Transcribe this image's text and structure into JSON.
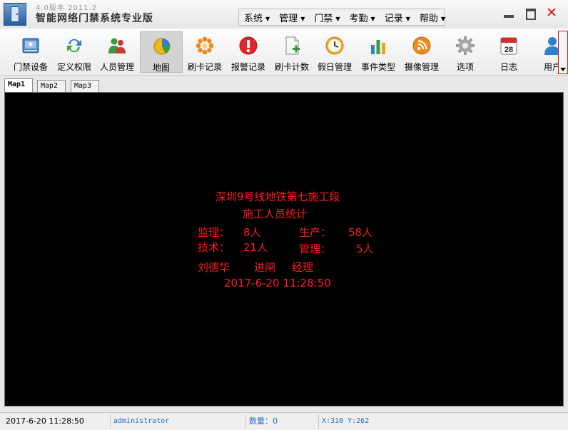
{
  "app": {
    "version": "4.0版本 2011.2",
    "title": "智能网络门禁系统专业版"
  },
  "menu": [
    {
      "label": "系统"
    },
    {
      "label": "管理"
    },
    {
      "label": "门禁"
    },
    {
      "label": "考勤"
    },
    {
      "label": "记录"
    },
    {
      "label": "帮助"
    }
  ],
  "toolbar": [
    {
      "label": "门禁设备",
      "icon": "door-device-icon"
    },
    {
      "label": "定义权限",
      "icon": "permission-arrows-icon"
    },
    {
      "label": "人员管理",
      "icon": "people-icon"
    },
    {
      "label": "地图",
      "icon": "map-pie-icon",
      "active": true
    },
    {
      "label": "刷卡记录",
      "icon": "card-record-icon"
    },
    {
      "label": "报警记录",
      "icon": "alarm-icon"
    },
    {
      "label": "刷卡计数",
      "icon": "card-count-icon"
    },
    {
      "label": "假日管理",
      "icon": "clock-icon"
    },
    {
      "label": "事件类型",
      "icon": "bar-chart-icon"
    },
    {
      "label": "摄像管理",
      "icon": "camera-feed-icon"
    },
    {
      "label": "选项",
      "icon": "gear-icon"
    },
    {
      "label": "日志",
      "icon": "calendar-icon",
      "calendar_day": "28"
    },
    {
      "label": "用户",
      "icon": "user-icon"
    }
  ],
  "tabs": [
    {
      "label": "Map1",
      "active": true
    },
    {
      "label": "Map2"
    },
    {
      "label": "Map3"
    }
  ],
  "map": {
    "color": "#ff1d1d",
    "title": "深圳9号线地铁第七施工段",
    "subtitle": "施工人员统计",
    "supervision_label": "监理：",
    "supervision_value": "8人",
    "production_label": "生产：",
    "production_value": "58人",
    "technical_label": "技术：",
    "technical_value": "21人",
    "management_label": "管理：",
    "management_value": "5人",
    "person_name": "刘德华",
    "event": "进闸",
    "role": "经理",
    "timestamp": "2017-6-20 11:28:50"
  },
  "status": {
    "datetime": "2017-6-20 11:28:50",
    "user": "administrator",
    "count": "数量：0",
    "coords": "X:310 Y:262"
  }
}
